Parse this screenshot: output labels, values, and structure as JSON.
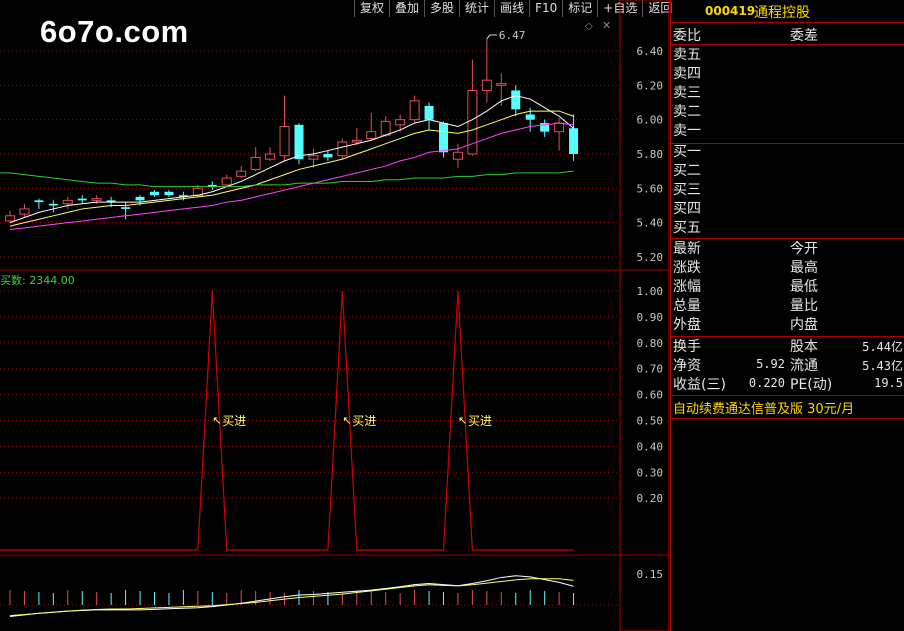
{
  "watermark": "6o7o.com",
  "toolbar": {
    "buttons": [
      "复权",
      "叠加",
      "多股",
      "统计",
      "画线",
      "F10",
      "标记",
      "+自选",
      "返回"
    ]
  },
  "colors": {
    "up": "#e0505a",
    "down": "#54ffff",
    "ma5": "#ffffff",
    "ma10": "#ffff66",
    "ma20": "#ff44ff",
    "ma60": "#2fd22f",
    "signal": "#d40000",
    "grid": "#a00000",
    "gold": "#ffd700"
  },
  "kline": {
    "y_ticks": [
      "6.40",
      "6.20",
      "6.00",
      "5.80",
      "5.60",
      "5.40",
      "5.20"
    ],
    "high_marker": "6.47"
  },
  "indicator": {
    "label": "买数: 2344.00",
    "y_ticks": [
      "1.00",
      "0.90",
      "0.80",
      "0.70",
      "0.60",
      "0.50",
      "0.40",
      "0.30",
      "0.20"
    ],
    "signals": [
      "买进",
      "买进",
      "买进"
    ]
  },
  "volume": {
    "y_tick": "0.15"
  },
  "quote": {
    "code": "000419",
    "name": "通程控股",
    "ratio_label": "委比",
    "diff_label": "委差",
    "sell": [
      "卖五",
      "卖四",
      "卖三",
      "卖二",
      "卖一"
    ],
    "buy": [
      "买一",
      "买二",
      "买三",
      "买四",
      "买五"
    ],
    "stats_left": [
      "最新",
      "涨跌",
      "涨幅",
      "总量",
      "外盘"
    ],
    "stats_right": [
      "今开",
      "最高",
      "最低",
      "量比",
      "内盘"
    ],
    "fin": [
      {
        "l1": "换手",
        "v1": "",
        "l2": "股本",
        "v2": "5.44亿"
      },
      {
        "l1": "净资",
        "v1": "5.92",
        "l2": "流通",
        "v2": "5.43亿"
      },
      {
        "l1": "收益(三)",
        "v1": "0.220",
        "l2": "PE(动)",
        "v2": "19.5"
      }
    ],
    "promo_text": "自动续费通达信普及版",
    "promo_price": "30元/月"
  },
  "chart_data": {
    "type": "candlestick",
    "candles": [
      {
        "o": 5.41,
        "c": 5.44,
        "h": 5.47,
        "l": 5.4
      },
      {
        "o": 5.45,
        "c": 5.48,
        "h": 5.51,
        "l": 5.43
      },
      {
        "o": 5.53,
        "c": 5.52,
        "h": 5.54,
        "l": 5.48
      },
      {
        "o": 5.51,
        "c": 5.5,
        "h": 5.53,
        "l": 5.46
      },
      {
        "o": 5.51,
        "c": 5.53,
        "h": 5.55,
        "l": 5.48
      },
      {
        "o": 5.54,
        "c": 5.53,
        "h": 5.56,
        "l": 5.51
      },
      {
        "o": 5.53,
        "c": 5.54,
        "h": 5.56,
        "l": 5.51
      },
      {
        "o": 5.53,
        "c": 5.52,
        "h": 5.55,
        "l": 5.49
      },
      {
        "o": 5.49,
        "c": 5.48,
        "h": 5.52,
        "l": 5.42
      },
      {
        "o": 5.55,
        "c": 5.53,
        "h": 5.56,
        "l": 5.5
      },
      {
        "o": 5.58,
        "c": 5.56,
        "h": 5.59,
        "l": 5.55
      },
      {
        "o": 5.58,
        "c": 5.56,
        "h": 5.59,
        "l": 5.55
      },
      {
        "o": 5.56,
        "c": 5.55,
        "h": 5.58,
        "l": 5.53
      },
      {
        "o": 5.56,
        "c": 5.6,
        "h": 5.62,
        "l": 5.55
      },
      {
        "o": 5.62,
        "c": 5.61,
        "h": 5.64,
        "l": 5.59
      },
      {
        "o": 5.62,
        "c": 5.66,
        "h": 5.68,
        "l": 5.61
      },
      {
        "o": 5.67,
        "c": 5.7,
        "h": 5.73,
        "l": 5.66
      },
      {
        "o": 5.71,
        "c": 5.78,
        "h": 5.84,
        "l": 5.7
      },
      {
        "o": 5.77,
        "c": 5.8,
        "h": 5.84,
        "l": 5.76
      },
      {
        "o": 5.79,
        "c": 5.96,
        "h": 6.14,
        "l": 5.76
      },
      {
        "o": 5.97,
        "c": 5.77,
        "h": 5.98,
        "l": 5.74
      },
      {
        "o": 5.77,
        "c": 5.79,
        "h": 5.83,
        "l": 5.72
      },
      {
        "o": 5.8,
        "c": 5.78,
        "h": 5.82,
        "l": 5.76
      },
      {
        "o": 5.79,
        "c": 5.87,
        "h": 5.89,
        "l": 5.77
      },
      {
        "o": 5.87,
        "c": 5.88,
        "h": 5.95,
        "l": 5.85
      },
      {
        "o": 5.89,
        "c": 5.93,
        "h": 6.04,
        "l": 5.88
      },
      {
        "o": 5.91,
        "c": 5.99,
        "h": 6.02,
        "l": 5.9
      },
      {
        "o": 5.97,
        "c": 6.0,
        "h": 6.03,
        "l": 5.93
      },
      {
        "o": 6.0,
        "c": 6.11,
        "h": 6.14,
        "l": 5.98
      },
      {
        "o": 6.08,
        "c": 6.0,
        "h": 6.1,
        "l": 5.94
      },
      {
        "o": 5.98,
        "c": 5.81,
        "h": 5.99,
        "l": 5.78
      },
      {
        "o": 5.77,
        "c": 5.81,
        "h": 5.86,
        "l": 5.72
      },
      {
        "o": 5.8,
        "c": 6.17,
        "h": 6.35,
        "l": 5.79
      },
      {
        "o": 6.17,
        "c": 6.23,
        "h": 6.47,
        "l": 6.1
      },
      {
        "o": 6.2,
        "c": 6.21,
        "h": 6.27,
        "l": 6.08
      },
      {
        "o": 6.17,
        "c": 6.06,
        "h": 6.2,
        "l": 6.02
      },
      {
        "o": 6.03,
        "c": 6.0,
        "h": 6.07,
        "l": 5.93
      },
      {
        "o": 5.98,
        "c": 5.93,
        "h": 6.0,
        "l": 5.9
      },
      {
        "o": 5.93,
        "c": 5.98,
        "h": 6.01,
        "l": 5.82
      },
      {
        "o": 5.95,
        "c": 5.8,
        "h": 6.03,
        "l": 5.76
      }
    ],
    "ma": [
      {
        "name": "MA5",
        "values": [
          5.4,
          5.43,
          5.46,
          5.48,
          5.5,
          5.51,
          5.52,
          5.52,
          5.52,
          5.52,
          5.53,
          5.54,
          5.55,
          5.56,
          5.58,
          5.61,
          5.64,
          5.68,
          5.72,
          5.76,
          5.79,
          5.8,
          5.82,
          5.84,
          5.86,
          5.88,
          5.91,
          5.94,
          5.98,
          6.0,
          5.98,
          5.96,
          6.0,
          6.05,
          6.11,
          6.14,
          6.12,
          6.07,
          6.02,
          5.95
        ]
      },
      {
        "name": "MA10",
        "values": [
          5.38,
          5.4,
          5.42,
          5.44,
          5.46,
          5.48,
          5.49,
          5.5,
          5.5,
          5.51,
          5.52,
          5.53,
          5.54,
          5.55,
          5.56,
          5.58,
          5.6,
          5.62,
          5.65,
          5.68,
          5.71,
          5.73,
          5.75,
          5.77,
          5.8,
          5.83,
          5.86,
          5.89,
          5.92,
          5.94,
          5.93,
          5.92,
          5.94,
          5.97,
          6.0,
          6.03,
          6.05,
          6.05,
          6.05,
          6.02
        ]
      },
      {
        "name": "MA20",
        "values": [
          5.36,
          5.37,
          5.38,
          5.39,
          5.4,
          5.41,
          5.42,
          5.43,
          5.44,
          5.45,
          5.46,
          5.47,
          5.48,
          5.49,
          5.5,
          5.52,
          5.53,
          5.55,
          5.57,
          5.59,
          5.61,
          5.63,
          5.65,
          5.67,
          5.69,
          5.71,
          5.73,
          5.76,
          5.78,
          5.81,
          5.82,
          5.83,
          5.86,
          5.89,
          5.92,
          5.94,
          5.96,
          5.97,
          5.98,
          5.97
        ]
      },
      {
        "name": "MA60",
        "values": [
          5.69,
          5.68,
          5.67,
          5.66,
          5.65,
          5.64,
          5.63,
          5.63,
          5.62,
          5.62,
          5.61,
          5.61,
          5.61,
          5.61,
          5.61,
          5.61,
          5.61,
          5.62,
          5.62,
          5.62,
          5.63,
          5.63,
          5.63,
          5.64,
          5.64,
          5.64,
          5.65,
          5.65,
          5.66,
          5.66,
          5.66,
          5.67,
          5.67,
          5.68,
          5.68,
          5.69,
          5.69,
          5.69,
          5.69,
          5.7
        ]
      }
    ],
    "signal_values": [
      0,
      0,
      0,
      0,
      0,
      0,
      0,
      0,
      0,
      0,
      0,
      0,
      0,
      0,
      1,
      0,
      0,
      0,
      0,
      0,
      0,
      0,
      0,
      1,
      0,
      0,
      0,
      0,
      0,
      0,
      0,
      1,
      0,
      0,
      0,
      0,
      0,
      0,
      0,
      0
    ],
    "ylim_price": [
      5.16,
      6.55
    ],
    "ylim_signal": [
      0,
      1.0
    ]
  }
}
